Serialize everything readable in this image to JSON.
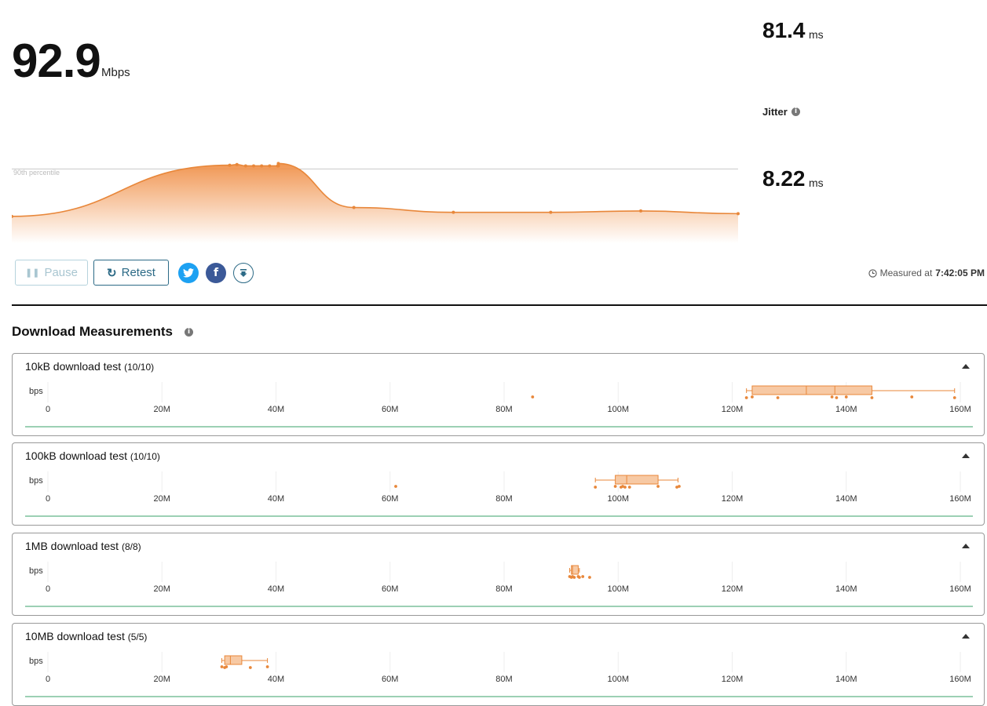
{
  "speed": {
    "value": "92.9",
    "unit": "Mbps"
  },
  "latency": {
    "value": "81.4",
    "unit": "ms"
  },
  "jitter": {
    "label": "Jitter",
    "value": "8.22",
    "unit": "ms"
  },
  "speed_chart": {
    "percentile_label": "90th percentile",
    "percentile_level": 0.95,
    "points": [
      [
        0.0,
        0.22
      ],
      [
        0.3,
        0.97
      ],
      [
        0.31,
        0.98
      ],
      [
        0.322,
        0.96
      ],
      [
        0.333,
        0.96
      ],
      [
        0.344,
        0.96
      ],
      [
        0.355,
        0.96
      ],
      [
        0.366,
        0.96
      ],
      [
        0.367,
        0.96
      ],
      [
        0.367,
        0.995
      ],
      [
        0.471,
        0.35
      ],
      [
        0.608,
        0.28
      ],
      [
        0.742,
        0.28
      ],
      [
        0.866,
        0.3
      ],
      [
        1.0,
        0.26
      ]
    ]
  },
  "controls": {
    "pause_label": "Pause",
    "retest_label": "Retest",
    "measured_prefix": "Measured at",
    "measured_time": "7:42:05 PM"
  },
  "download": {
    "title": "Download Measurements",
    "axis_unit": "bps",
    "axis_ticks": [
      "0",
      "20M",
      "40M",
      "60M",
      "80M",
      "100M",
      "120M",
      "140M",
      "160M"
    ],
    "axis_max": 160,
    "tests": [
      {
        "label": "10kB download test",
        "count": "(10/10)",
        "box": {
          "min": 122.5,
          "q1": 123.5,
          "median": 133,
          "mean": 138,
          "q3": 144.5,
          "max": 159
        },
        "points": [
          85,
          122.5,
          123.5,
          128,
          137.5,
          138.3,
          140,
          144.5,
          151.5,
          159
        ]
      },
      {
        "label": "100kB download test",
        "count": "(10/10)",
        "box": {
          "min": 96,
          "q1": 99.5,
          "median": 101.5,
          "mean": 101.5,
          "q3": 107,
          "max": 110.5
        },
        "points": [
          61,
          96,
          99.5,
          100.5,
          100.8,
          102,
          107,
          110.3,
          110.7,
          101.2
        ]
      },
      {
        "label": "1MB download test",
        "count": "(8/8)",
        "box": {
          "min": 91.5,
          "q1": 91.8,
          "median": 92,
          "mean": 92,
          "q3": 93,
          "max": 93.2
        },
        "points": [
          91.5,
          91.8,
          92,
          92.3,
          93,
          93.2,
          93.8,
          95
        ]
      },
      {
        "label": "10MB download test",
        "count": "(5/5)",
        "box": {
          "min": 30.5,
          "q1": 31,
          "median": 32,
          "mean": 32,
          "q3": 34,
          "max": 38.5
        },
        "points": [
          30.5,
          31,
          31.3,
          35.5,
          38.5
        ]
      }
    ]
  },
  "colors": {
    "accent": "#e8873a",
    "box_fill": "#f7c9a4",
    "baseline": "#38a169",
    "twitter": "#1da1f2",
    "facebook": "#3b5998",
    "button_blue": "#2c6a86"
  }
}
